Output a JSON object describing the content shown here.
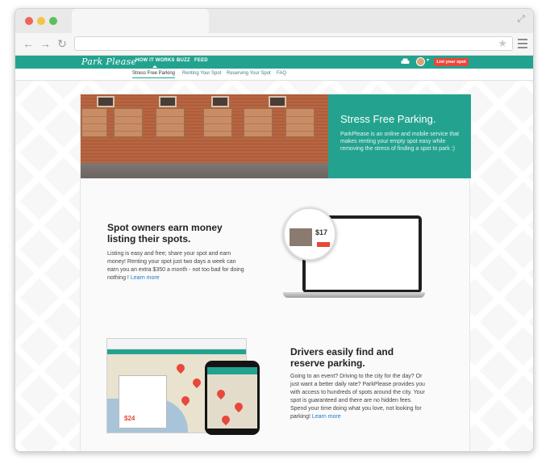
{
  "browser": {
    "address": ""
  },
  "site": {
    "logo": "Park Please",
    "nav": [
      "HOW IT WORKS",
      "BUZZ",
      "FEED"
    ],
    "cta": "List your spot",
    "subnav": [
      "Stress Free Parking",
      "Renting Your Spot",
      "Reserving Your Spot",
      "FAQ"
    ]
  },
  "hero": {
    "title": "Stress Free Parking.",
    "text": "ParkPlease is an online and mobile service that makes renting your empty spot easy while removing the stress of finding a spot to park :)"
  },
  "section1": {
    "title": "Spot owners earn money listing their spots.",
    "text": "Listing is easy and free; share your spot and earn money! Renting your spot just two days a week can earn you an extra $350 a month - not too bad for doing nothing ! ",
    "link": "Learn more",
    "price": "$17"
  },
  "section2": {
    "title": "Drivers easily find and reserve parking.",
    "text": "Going to an event? Driving to the city for the day? Or just want a better daily rate? ParkPlease provides you with access to hundreds of spots around the city. Your spot is guaranteed and there are no hidden fees. Spend your time doing what you love, not looking for parking! ",
    "link": "Learn more",
    "price": "$24"
  }
}
